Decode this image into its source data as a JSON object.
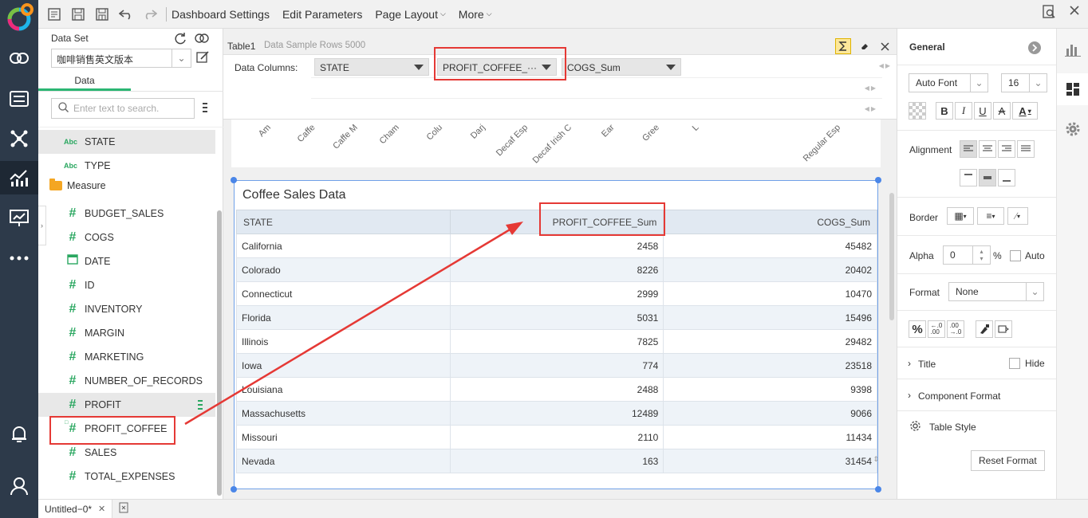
{
  "toolbar": {
    "menus": [
      "Dashboard Settings",
      "Edit Parameters",
      "Page Layout",
      "More"
    ]
  },
  "data_panel": {
    "title": "Data Set",
    "dataset": "咖啡销售英文版本",
    "tab": "Data",
    "search_placeholder": "Enter text to search.",
    "folder": "Measure",
    "dimension_fields": [
      "STATE",
      "TYPE"
    ],
    "measure_fields": [
      "BUDGET_SALES",
      "COGS",
      "DATE",
      "ID",
      "INVENTORY",
      "MARGIN",
      "MARKETING",
      "NUMBER_OF_RECORDS",
      "PROFIT",
      "PROFIT_COFFEE",
      "SALES",
      "TOTAL_EXPENSES"
    ]
  },
  "component": {
    "name": "Table1",
    "sample": "Data Sample Rows 5000",
    "columns_label": "Data Columns:",
    "chips": [
      "STATE",
      "PROFIT_COFFEE_···",
      "COGS_Sum"
    ]
  },
  "chart_strip": {
    "labels": [
      "Am",
      "Caffe",
      "Caffe M",
      "Cham",
      "Colu",
      "Darj",
      "Decaf Esp",
      "Decaf Irish C",
      "Ear",
      "Gree",
      "L",
      "Regular Esp"
    ]
  },
  "table": {
    "title": "Coffee Sales Data",
    "headers": [
      "STATE",
      "PROFIT_COFFEE_Sum",
      "COGS_Sum"
    ],
    "rows": [
      [
        "California",
        "2458",
        "45482"
      ],
      [
        "Colorado",
        "8226",
        "20402"
      ],
      [
        "Connecticut",
        "2999",
        "10470"
      ],
      [
        "Florida",
        "5031",
        "15496"
      ],
      [
        "Illinois",
        "7825",
        "29482"
      ],
      [
        "Iowa",
        "774",
        "23518"
      ],
      [
        "Louisiana",
        "2488",
        "9398"
      ],
      [
        "Massachusetts",
        "12489",
        "9066"
      ],
      [
        "Missouri",
        "2110",
        "11434"
      ],
      [
        "Nevada",
        "163",
        "31454"
      ]
    ]
  },
  "props": {
    "general": "General",
    "font": "Auto Font",
    "font_size": "16",
    "alignment": "Alignment",
    "border": "Border",
    "alpha": "Alpha",
    "alpha_value": "0",
    "percent": "%",
    "auto": "Auto",
    "format": "Format",
    "format_value": "None",
    "title": "Title",
    "hide": "Hide",
    "component_format": "Component Format",
    "table_style": "Table Style",
    "reset": "Reset Format"
  },
  "bottom": {
    "tab": "Untitled−0*"
  },
  "colors": {
    "accent_green": "#2bb673",
    "annotation_red": "#e53935",
    "selection_blue": "#4a86e8"
  }
}
